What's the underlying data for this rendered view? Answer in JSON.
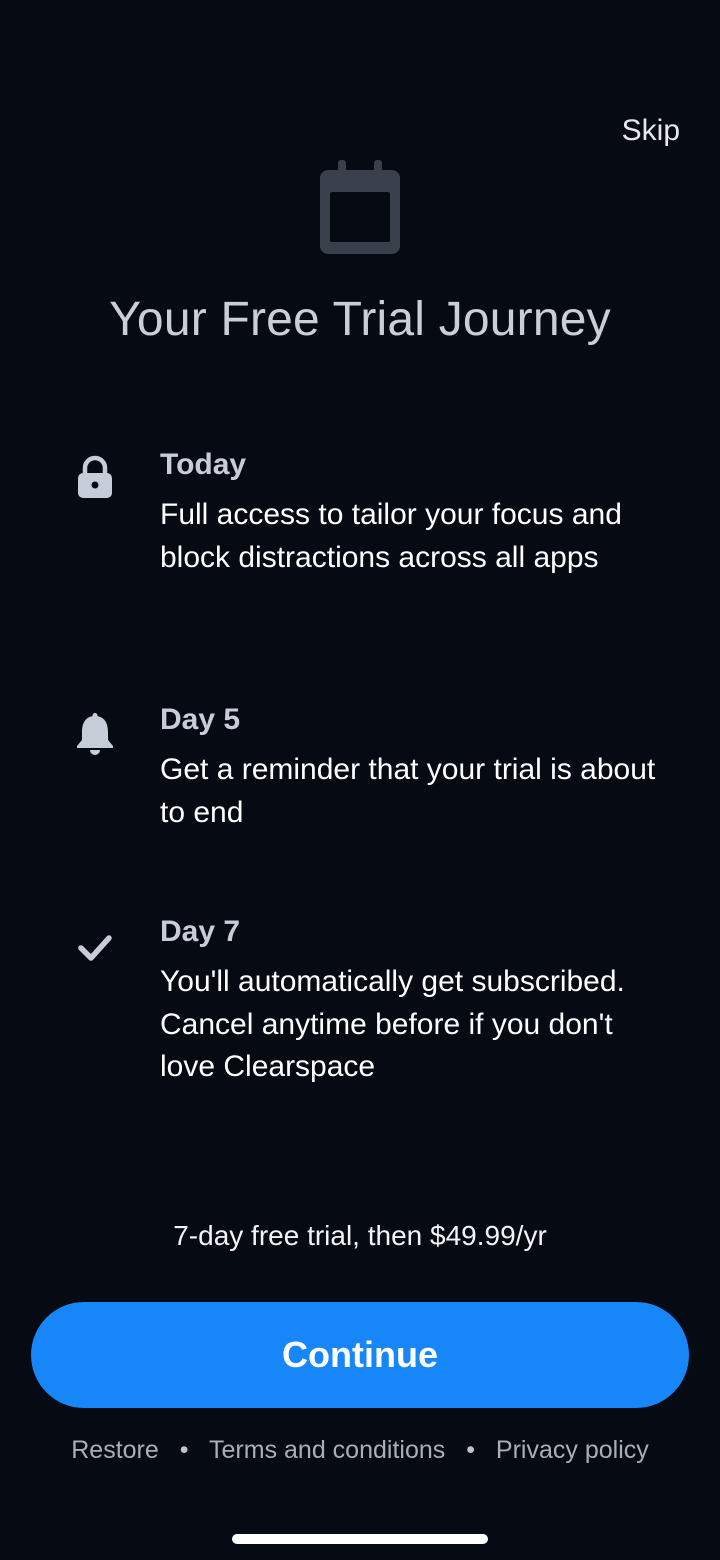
{
  "header": {
    "skip_label": "Skip"
  },
  "hero": {
    "icon": "calendar-icon",
    "title": "Your Free Trial Journey"
  },
  "steps": [
    {
      "icon": "lock-icon",
      "heading": "Today",
      "text": "Full access to tailor your focus and block distractions across all apps"
    },
    {
      "icon": "bell-icon",
      "heading": "Day 5",
      "text": "Get a reminder that your trial is about to end"
    },
    {
      "icon": "checkmark-icon",
      "heading": "Day 7",
      "text": "You'll automatically get subscribed. Cancel anytime before if you don't love Clearspace"
    }
  ],
  "pricing": {
    "text": "7-day free trial, then $49.99/yr"
  },
  "cta": {
    "continue_label": "Continue"
  },
  "footer": {
    "restore_label": "Restore",
    "separator": "•",
    "terms_label": "Terms and conditions",
    "privacy_label": "Privacy policy"
  },
  "colors": {
    "background": "#060b13",
    "accent": "#1786f8",
    "icon_muted": "#3a404b",
    "step_icon": "#c7cdd8"
  }
}
